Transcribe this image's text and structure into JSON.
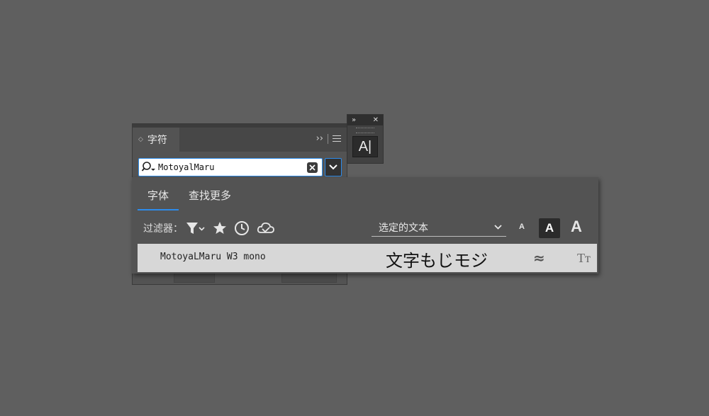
{
  "character_panel": {
    "tab_label": "字符",
    "search_value": "MotoyalMaru"
  },
  "font_popup": {
    "tabs": [
      "字体",
      "查找更多"
    ],
    "active_tab": 0,
    "filter_label": "过滤器：",
    "preview_text_option": "选定的文本",
    "size_buttons": [
      "A",
      "A",
      "A"
    ],
    "result": {
      "font_name": "MotoyaLMaru W3 mono",
      "sample_text": "文字もじモジ",
      "similar_symbol": "≈",
      "type_symbol": "Tт"
    }
  },
  "mini_panel": {
    "icon_label": "A|"
  },
  "colors": {
    "accent": "#2d8ceb",
    "background": "#5f5f5f",
    "panel": "#535353",
    "result_row": "#d7d7d7"
  }
}
